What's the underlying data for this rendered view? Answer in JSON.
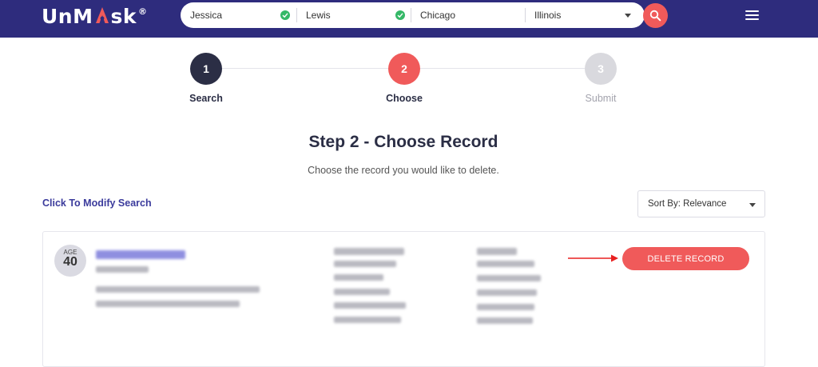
{
  "header": {
    "logo_prefix": "Un",
    "logo_suffix": "sk",
    "logo_registered": "®",
    "search": {
      "first_name": "Jessica",
      "last_name": "Lewis",
      "city": "Chicago",
      "state": "Illinois"
    }
  },
  "steps": [
    {
      "number": "1",
      "label": "Search",
      "state": "complete"
    },
    {
      "number": "2",
      "label": "Choose",
      "state": "active"
    },
    {
      "number": "3",
      "label": "Submit",
      "state": "pending"
    }
  ],
  "main": {
    "title": "Step 2 - Choose Record",
    "subtitle": "Choose the record you would like to delete.",
    "modify_link": "Click To Modify Search",
    "sort_label": "Sort By: Relevance"
  },
  "record": {
    "age_label": "AGE",
    "age_value": "40",
    "delete_label": "DELETE RECORD"
  },
  "colors": {
    "header_bg": "#2e2c7d",
    "accent": "#f05a5a",
    "step_complete": "#2b2e45",
    "step_pending": "#d9d9de",
    "link": "#3b3b9c",
    "check": "#35b867"
  }
}
